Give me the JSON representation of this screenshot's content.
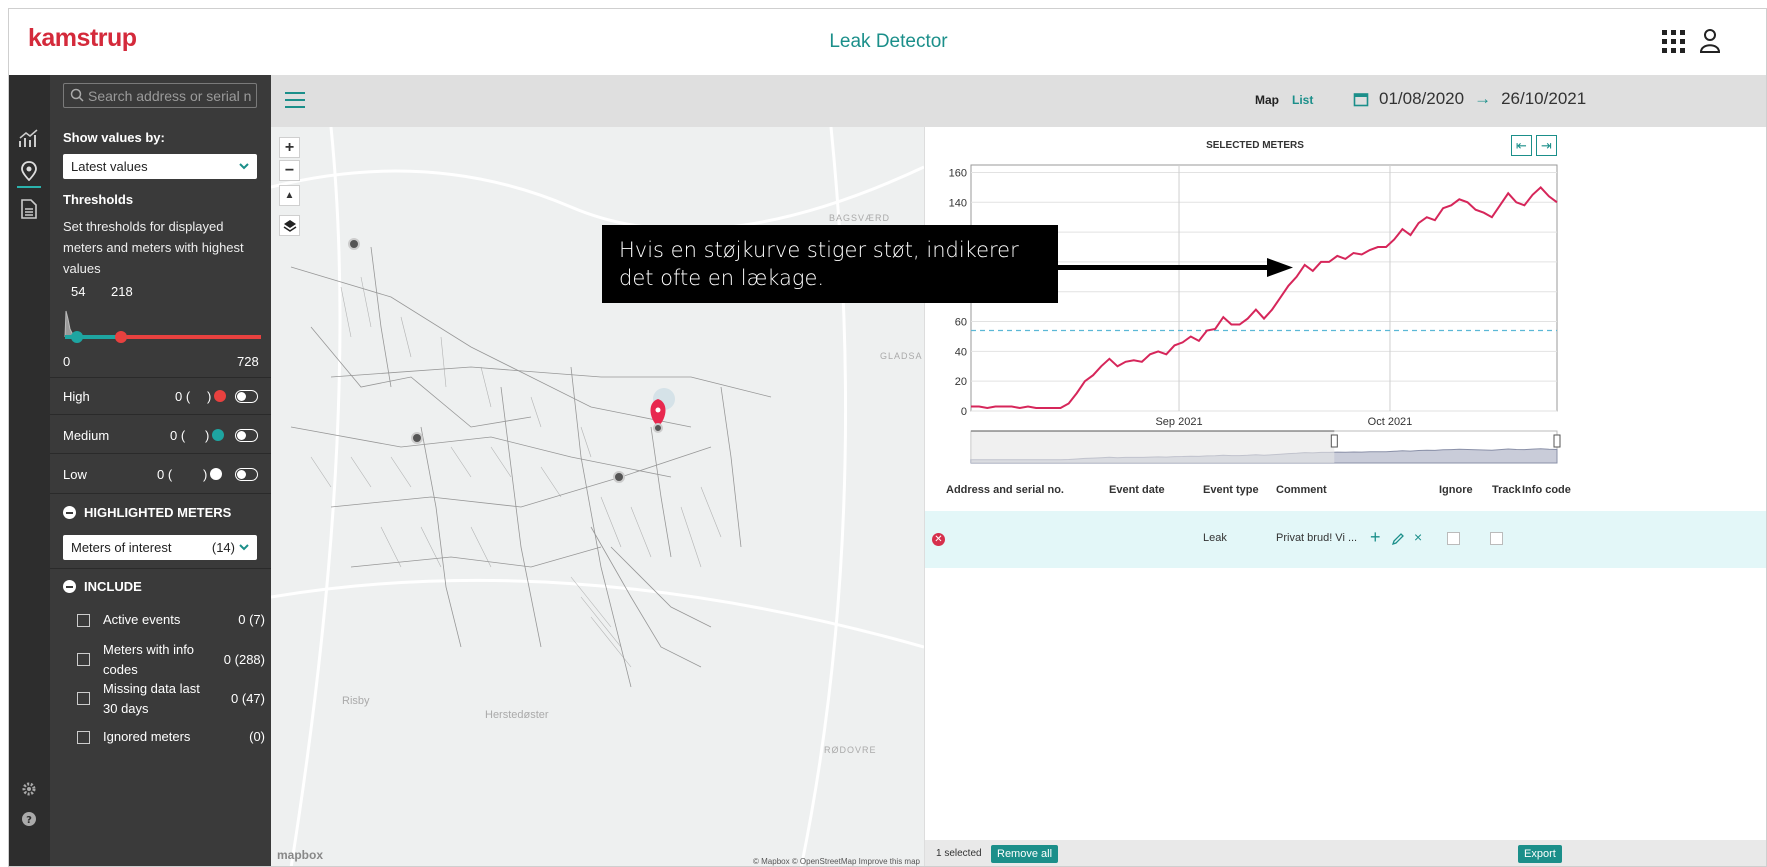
{
  "header": {
    "brand": "kamstrup",
    "title": "Leak Detector"
  },
  "sidebar": {
    "search_placeholder": "Search address or serial no.",
    "show_values_label": "Show values by:",
    "show_values_selected": "Latest values",
    "thresholds_title": "Thresholds",
    "thresholds_note": "Set thresholds for displayed meters and meters with highest values",
    "slider": {
      "low": "54",
      "high": "218",
      "min": "0",
      "max": "728"
    },
    "levels": [
      {
        "label": "High",
        "count": "0 (",
        "close": ")",
        "color": "#e8413f"
      },
      {
        "label": "Medium",
        "count": "0 (",
        "close": ")",
        "color": "#1ea5a1"
      },
      {
        "label": "Low",
        "count": "0 (",
        "close": ")",
        "color": "#ffffff"
      }
    ],
    "highlighted_title": "HIGHLIGHTED METERS",
    "highlighted_selected": "Meters of interest",
    "highlighted_count": "(14)",
    "include_title": "INCLUDE",
    "include_items": [
      {
        "label": "Active events",
        "count": "0 (7)"
      },
      {
        "label": "Meters with info codes",
        "count": "0 (288)"
      },
      {
        "label": "Missing data last 30 days",
        "count": "0 (47)"
      },
      {
        "label": "Ignored meters",
        "count": "(0)"
      }
    ]
  },
  "toolbar": {
    "map_label": "Map",
    "list_label": "List",
    "date_from": "01/08/2020",
    "date_arrow": "→",
    "date_to": "26/10/2021"
  },
  "map": {
    "labels": [
      "BAGSVÆRD",
      "GLADSA",
      "Risby",
      "Herstedøster",
      "RØDOVRE"
    ],
    "attribution": "© Mapbox © OpenStreetMap Improve this map",
    "logo": "mapbox"
  },
  "chart": {
    "header": "SELECTED METERS"
  },
  "chart_data": {
    "type": "line",
    "title": "SELECTED METERS",
    "x_ticks": [
      "Sep 2021",
      "Oct 2021"
    ],
    "y_ticks": [
      0,
      20,
      40,
      60,
      140,
      160
    ],
    "ylim": [
      0,
      165
    ],
    "threshold": 54,
    "series": [
      {
        "values": [
          3,
          3,
          2,
          3,
          3,
          3,
          2,
          3,
          2,
          2,
          2,
          2,
          5,
          12,
          20,
          24,
          30,
          35,
          30,
          33,
          34,
          33,
          38,
          40,
          38,
          44,
          46,
          50,
          47,
          54,
          55,
          63,
          58,
          58,
          62,
          68,
          62,
          68,
          76,
          84,
          90,
          98,
          94,
          100,
          100,
          104,
          102,
          106,
          105,
          108,
          110,
          110,
          115,
          122,
          118,
          126,
          130,
          128,
          136,
          138,
          142,
          140,
          135,
          133,
          130,
          138,
          146,
          140,
          138,
          145,
          150,
          144,
          140
        ]
      }
    ],
    "color": "#d6265a"
  },
  "table": {
    "headers": [
      "Address and serial no.",
      "Event date",
      "Event type",
      "Comment",
      "Ignore",
      "Track",
      "Info code"
    ],
    "rows": [
      {
        "event_type": "Leak",
        "comment": "Privat brud! Vi ..."
      }
    ]
  },
  "footer": {
    "selected": "1 selected",
    "remove_all": "Remove all",
    "export": "Export"
  },
  "callout": {
    "text": "Hvis en støjkurve stiger støt, indikerer det ofte en lækage."
  }
}
